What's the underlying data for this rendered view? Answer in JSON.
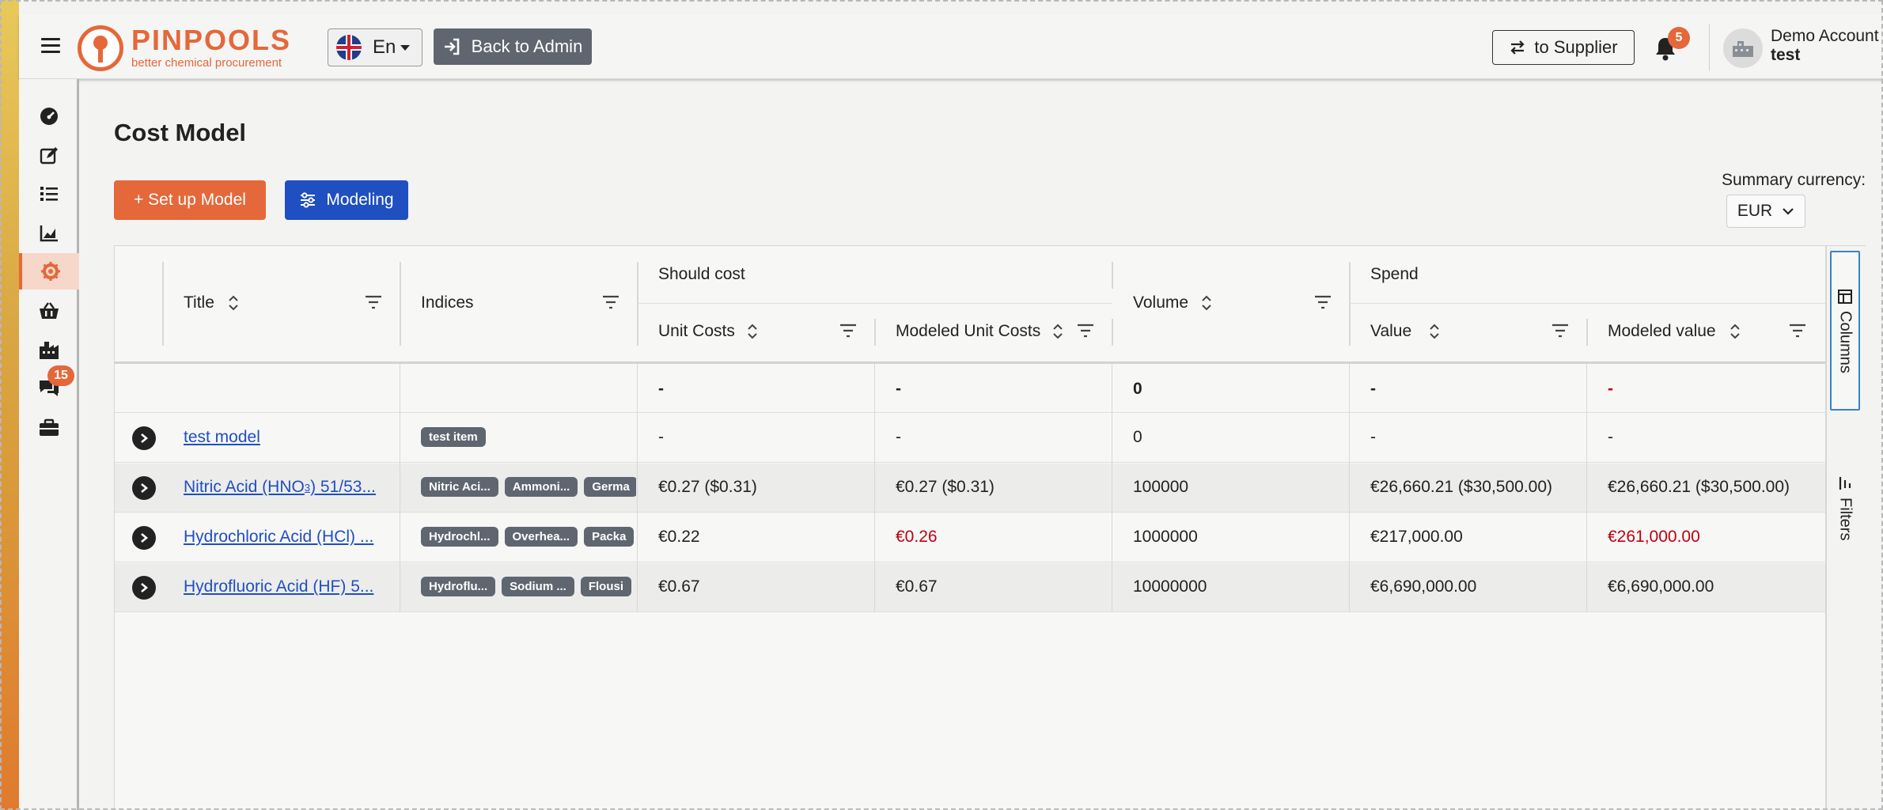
{
  "header": {
    "brand_title": "PINPOOLS",
    "brand_subtitle": "better chemical procurement",
    "language": "En",
    "back_admin_label": "Back to Admin",
    "to_supplier_label": "to Supplier",
    "notifications_count": "5",
    "account_name": "Demo Account",
    "account_sub": "test"
  },
  "sidebar": {
    "items": [
      {
        "icon": "dashboard-icon"
      },
      {
        "icon": "edit-icon"
      },
      {
        "icon": "list-icon"
      },
      {
        "icon": "chart-icon"
      },
      {
        "icon": "cost-model-icon"
      },
      {
        "icon": "basket-icon"
      },
      {
        "icon": "factory-icon"
      },
      {
        "icon": "chat-icon"
      },
      {
        "icon": "briefcase-icon"
      }
    ],
    "chat_badge": "15"
  },
  "page": {
    "title": "Cost Model",
    "setup_label": "+ Set up Model",
    "modeling_label": "Modeling",
    "summary_currency_label": "Summary currency:",
    "currency_value": "EUR"
  },
  "grid": {
    "group_headers": {
      "should_cost": "Should cost",
      "spend": "Spend"
    },
    "columns": {
      "title": "Title",
      "indices": "Indices",
      "unit_costs": "Unit Costs",
      "modeled_unit_costs": "Modeled Unit Costs",
      "volume": "Volume",
      "value": "Value",
      "modeled_value": "Modeled value"
    },
    "summary_row": {
      "unit_costs": "-",
      "modeled_unit_costs": "-",
      "volume": "0",
      "value": "-",
      "modeled_value": "-"
    },
    "rows": [
      {
        "title": "test model",
        "tags": [
          "test item"
        ],
        "unit_costs": "-",
        "modeled_unit_costs": "-",
        "volume": "0",
        "value": "-",
        "modeled_value": "-"
      },
      {
        "title": "Nitric Acid (HNO",
        "title_sub": "3",
        "title_rest": ") 51/53...",
        "tags": [
          "Nitric Aci...",
          "Ammoni...",
          "Germa"
        ],
        "unit_costs": "€0.27 ($0.31)",
        "modeled_unit_costs": "€0.27 ($0.31)",
        "volume": "100000",
        "value": "€26,660.21 ($30,500.00)",
        "modeled_value": "€26,660.21 ($30,500.00)"
      },
      {
        "title": "Hydrochloric Acid (HCl) ...",
        "tags": [
          "Hydrochl...",
          "Overhea...",
          "Packa"
        ],
        "unit_costs": "€0.22",
        "modeled_unit_costs": "€0.26",
        "volume": "1000000",
        "value": "€217,000.00",
        "modeled_value": "€261,000.00"
      },
      {
        "title": "Hydrofluoric Acid (HF) 5...",
        "tags": [
          "Hydroflu...",
          "Sodium ...",
          "Flousi"
        ],
        "unit_costs": "€0.67",
        "modeled_unit_costs": "€0.67",
        "volume": "10000000",
        "value": "€6,690,000.00",
        "modeled_value": "€6,690,000.00"
      }
    ]
  },
  "side_panel": {
    "columns_label": "Columns",
    "filters_label": "Filters"
  },
  "colors": {
    "brand_orange": "#e4683a",
    "modeling_blue": "#1f4fc0",
    "negative_red": "#c0000f"
  }
}
